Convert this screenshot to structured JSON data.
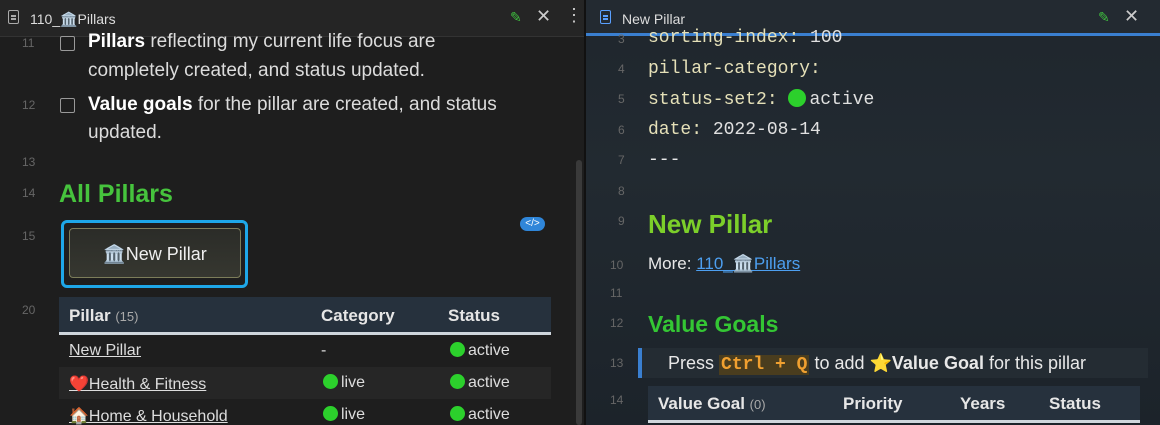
{
  "left_tab": {
    "title": "110_🏛️Pillars",
    "edit_icon": "pencil-icon",
    "close_icon": "close-icon",
    "more_icon": "more-icon"
  },
  "right_tab": {
    "title": "New Pillar",
    "edit_icon": "pencil-icon",
    "close_icon": "close-icon"
  },
  "left": {
    "lines": [
      {
        "num": "11",
        "bold": "Pillars",
        "text": " reflecting my current life focus are",
        "cont": "completely created, and status updated."
      },
      {
        "num": "12",
        "bold": "Value goals",
        "text": " for the pillar are created, and status",
        "cont": "updated."
      }
    ],
    "ln13": "13",
    "ln14": "14",
    "heading": "All Pillars",
    "ln15": "15",
    "code_badge": "</>",
    "button_label": "🏛️New Pillar",
    "ln20": "20",
    "table": {
      "headers": {
        "pillar": "Pillar",
        "count": "(15)",
        "category": "Category",
        "status": "Status"
      },
      "rows": [
        {
          "pillar": "New Pillar",
          "category": "-",
          "status": "active"
        },
        {
          "pillar": "❤️Health & Fitness",
          "category": "live",
          "status": "active"
        },
        {
          "pillar": "🏠Home & Household",
          "category": "live",
          "status": "active"
        }
      ]
    }
  },
  "right": {
    "frontmatter": [
      {
        "num": "3",
        "key": "sorting-index",
        "value": "100"
      },
      {
        "num": "4",
        "key": "pillar-category",
        "value": ""
      },
      {
        "num": "5",
        "key": "status-set2",
        "value": "active"
      },
      {
        "num": "6",
        "key": "date",
        "value": "2022-08-14"
      },
      {
        "num": "7",
        "key": "---",
        "value": ""
      }
    ],
    "ln8": "8",
    "ln9": "9",
    "heading": "New Pillar",
    "ln10": "10",
    "more_label": "More: ",
    "more_link": "110_🏛️Pillars",
    "ln11": "11",
    "ln12": "12",
    "subheading": "Value Goals",
    "ln13": "13",
    "callout": {
      "pre": "Press ",
      "kbd": "Ctrl + Q",
      "mid": " to add ",
      "star": "⭐",
      "bold": "Value Goal",
      "post": " for this pillar"
    },
    "ln14": "14",
    "table": {
      "value_goal": "Value Goal",
      "count": "(0)",
      "priority": "Priority",
      "years": "Years",
      "status": "Status"
    }
  }
}
